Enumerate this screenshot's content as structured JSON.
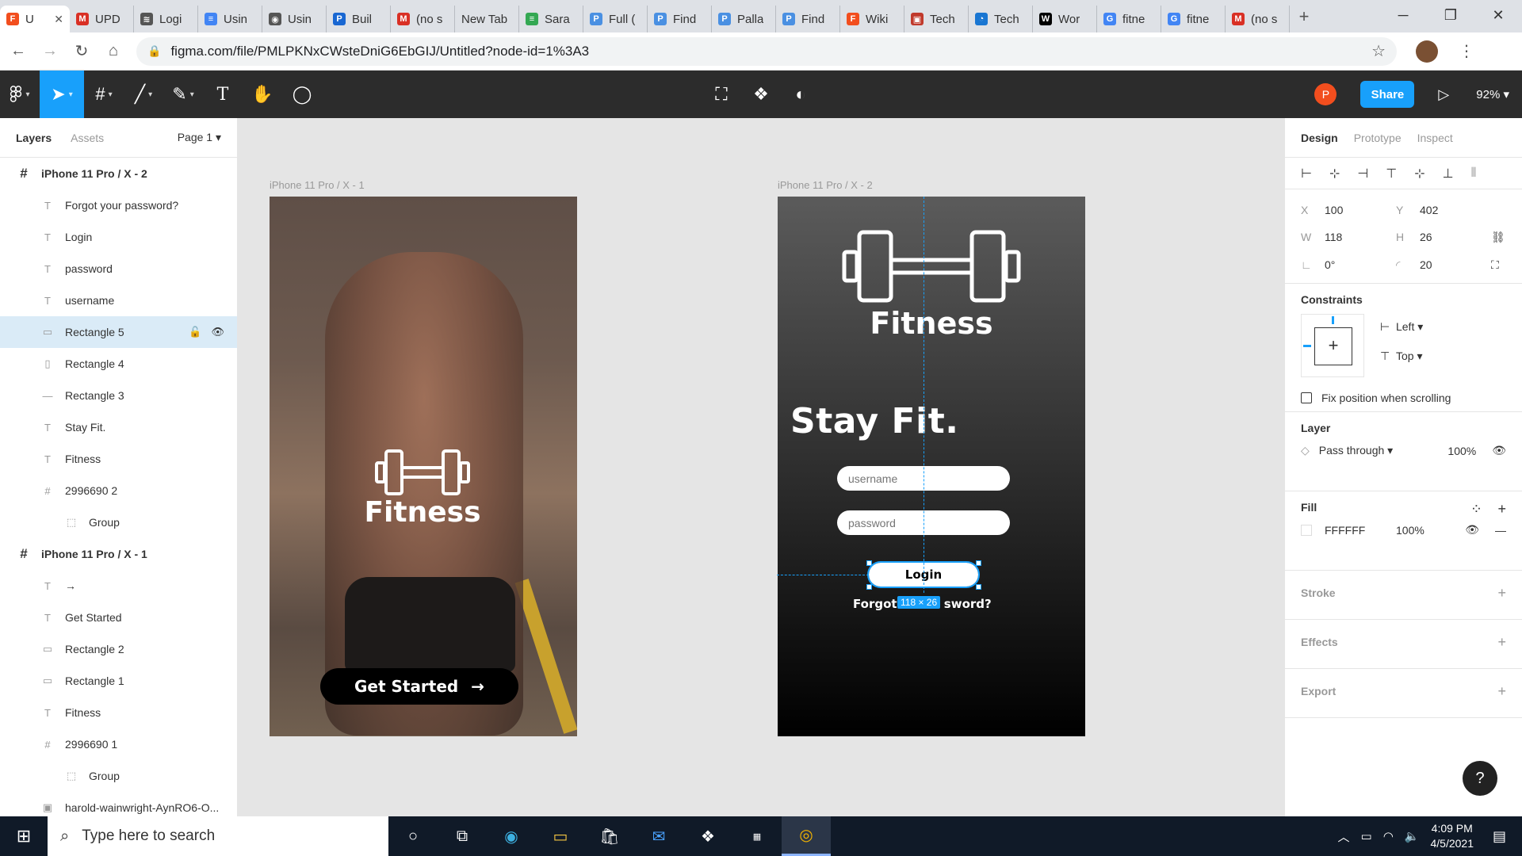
{
  "browser": {
    "tabs": [
      {
        "label": "U",
        "color": "#f24e1e",
        "glyph": "F",
        "active": true
      },
      {
        "label": "UPD",
        "color": "#d93025",
        "glyph": "M"
      },
      {
        "label": "Logi",
        "color": "#555555",
        "glyph": "≋"
      },
      {
        "label": "Usin",
        "color": "#4285f4",
        "glyph": "≡"
      },
      {
        "label": "Usin",
        "color": "#555555",
        "glyph": "◉"
      },
      {
        "label": "Buil",
        "color": "#1967d2",
        "glyph": "P"
      },
      {
        "label": "(no s",
        "color": "#d93025",
        "glyph": "M"
      },
      {
        "label": "New Tab",
        "color": "",
        "glyph": ""
      },
      {
        "label": "Sara",
        "color": "#34a853",
        "glyph": "≡"
      },
      {
        "label": "Full (",
        "color": "#4a90e2",
        "glyph": "P"
      },
      {
        "label": "Find",
        "color": "#4a90e2",
        "glyph": "P"
      },
      {
        "label": "Palla",
        "color": "#4a90e2",
        "glyph": "P"
      },
      {
        "label": "Find",
        "color": "#4a90e2",
        "glyph": "P"
      },
      {
        "label": "Wiki",
        "color": "#f24e1e",
        "glyph": "F"
      },
      {
        "label": "Tech",
        "color": "#c0392b",
        "glyph": "▣"
      },
      {
        "label": "Tech",
        "color": "#1976d2",
        "glyph": "◔"
      },
      {
        "label": "Wor",
        "color": "#000000",
        "glyph": "W"
      },
      {
        "label": "fitne",
        "color": "#4285f4",
        "glyph": "G"
      },
      {
        "label": "fitne",
        "color": "#4285f4",
        "glyph": "G"
      },
      {
        "label": "(no s",
        "color": "#d93025",
        "glyph": "M"
      }
    ],
    "url": "figma.com/file/PMLPKNxCWsteDniG6EbGIJ/Untitled?node-id=1%3A3"
  },
  "toolbar": {
    "share_label": "Share",
    "avatar_initial": "P",
    "zoom": "92%"
  },
  "left_panel": {
    "tab_layers": "Layers",
    "tab_assets": "Assets",
    "page": "Page 1",
    "layers": [
      {
        "name": "iPhone 11 Pro / X - 2",
        "type": "frame",
        "indent": 0
      },
      {
        "name": "Forgot your password?",
        "type": "text",
        "indent": 1
      },
      {
        "name": "Login",
        "type": "text",
        "indent": 1
      },
      {
        "name": "password",
        "type": "text",
        "indent": 1
      },
      {
        "name": "username",
        "type": "text",
        "indent": 1
      },
      {
        "name": "Rectangle 5",
        "type": "rect",
        "indent": 1,
        "selected": true
      },
      {
        "name": "Rectangle 4",
        "type": "rect-tall",
        "indent": 1
      },
      {
        "name": "Rectangle 3",
        "type": "line",
        "indent": 1
      },
      {
        "name": "Stay Fit.",
        "type": "text",
        "indent": 1
      },
      {
        "name": "Fitness",
        "type": "text",
        "indent": 1
      },
      {
        "name": "2996690 2",
        "type": "frame",
        "indent": 1
      },
      {
        "name": "Group",
        "type": "group",
        "indent": 2
      },
      {
        "name": "iPhone 11 Pro / X - 1",
        "type": "frame",
        "indent": 0
      },
      {
        "name": "→",
        "type": "text",
        "indent": 1
      },
      {
        "name": "Get Started",
        "type": "text",
        "indent": 1
      },
      {
        "name": "Rectangle 2",
        "type": "rect",
        "indent": 1
      },
      {
        "name": "Rectangle 1",
        "type": "rect-outline",
        "indent": 1
      },
      {
        "name": "Fitness",
        "type": "text",
        "indent": 1
      },
      {
        "name": "2996690 1",
        "type": "frame",
        "indent": 1
      },
      {
        "name": "Group",
        "type": "group",
        "indent": 2
      },
      {
        "name": "harold-wainwright-AynRO6-O...",
        "type": "image",
        "indent": 1
      }
    ]
  },
  "canvas": {
    "frame1_label": "iPhone 11 Pro / X - 1",
    "frame2_label": "iPhone 11 Pro / X - 2",
    "frame1_logo": "Fitness",
    "get_started": "Get Started",
    "get_started_arrow": "→",
    "frame2_logo": "Fitness",
    "stay_fit": "Stay Fit.",
    "username_placeholder": "username",
    "password_placeholder": "password",
    "login": "Login",
    "forgot_left": "Forgot ",
    "forgot_right": "sword?",
    "dimension_badge": "118 × 26"
  },
  "right_panel": {
    "tabs": {
      "design": "Design",
      "prototype": "Prototype",
      "inspect": "Inspect"
    },
    "x_label": "X",
    "x": "100",
    "y_label": "Y",
    "y": "402",
    "w_label": "W",
    "w": "118",
    "h_label": "H",
    "h": "26",
    "rotation": "0°",
    "radius": "20",
    "constraints_title": "Constraints",
    "constraint_h": "Left",
    "constraint_v": "Top",
    "fix_position": "Fix position when scrolling",
    "layer_title": "Layer",
    "blend": "Pass through",
    "layer_opacity": "100%",
    "fill_title": "Fill",
    "fill_hex": "FFFFFF",
    "fill_opacity": "100%",
    "stroke_title": "Stroke",
    "effects_title": "Effects",
    "export_title": "Export",
    "help": "?"
  },
  "taskbar": {
    "search_placeholder": "Type here to search",
    "time": "4:09 PM",
    "date": "4/5/2021"
  },
  "colors": {
    "figma_blue": "#18a0fb",
    "toolbar_bg": "#2c2c2c",
    "selected_layer_bg": "#daebf7"
  }
}
